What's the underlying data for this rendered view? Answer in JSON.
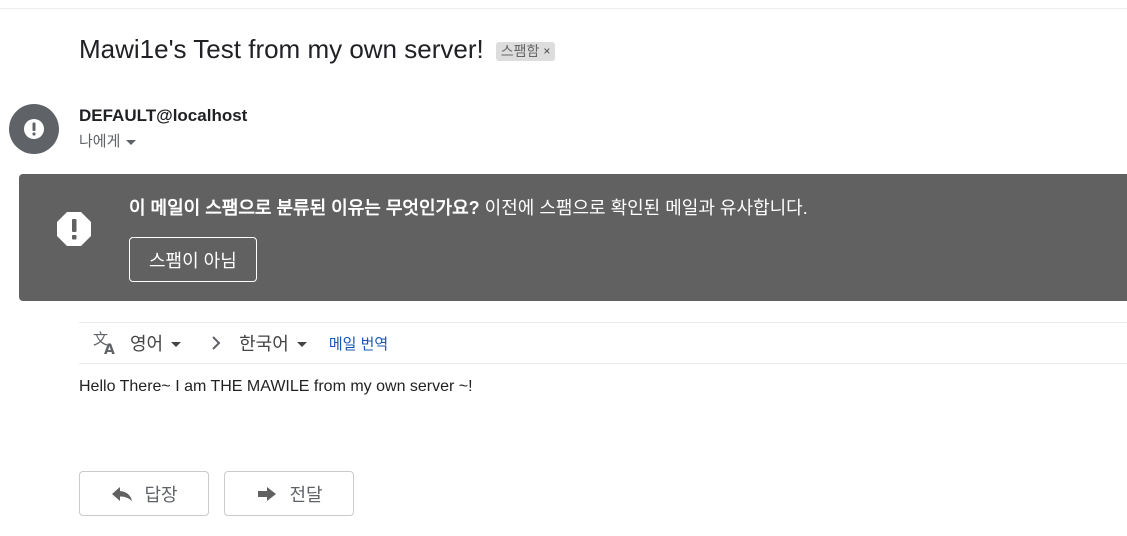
{
  "message": {
    "subject": "Mawi1e's Test from my own server!",
    "label_chip": "스팸함",
    "label_close": "×",
    "sender": "DEFAULT@localhost",
    "recipient": "나에게",
    "body": "Hello There~ I am THE MAWILE from my own server ~!"
  },
  "spam_banner": {
    "question": "이 메일이 스팸으로 분류된 이유는 무엇인가요?",
    "reason": " 이전에 스팸으로 확인된 메일과 유사합니다.",
    "not_spam_label": "스팸이 아님",
    "icon": "alert-icon",
    "background": "#616161"
  },
  "translate": {
    "source_lang": "영어",
    "target_lang": "한국어",
    "link_label": "메일 번역",
    "icon": "translate-icon"
  },
  "actions": {
    "reply_label": "답장",
    "forward_label": "전달"
  },
  "colors": {
    "avatar": "#5f6368",
    "link": "#1a56b5",
    "chip_bg": "#dddddd"
  }
}
